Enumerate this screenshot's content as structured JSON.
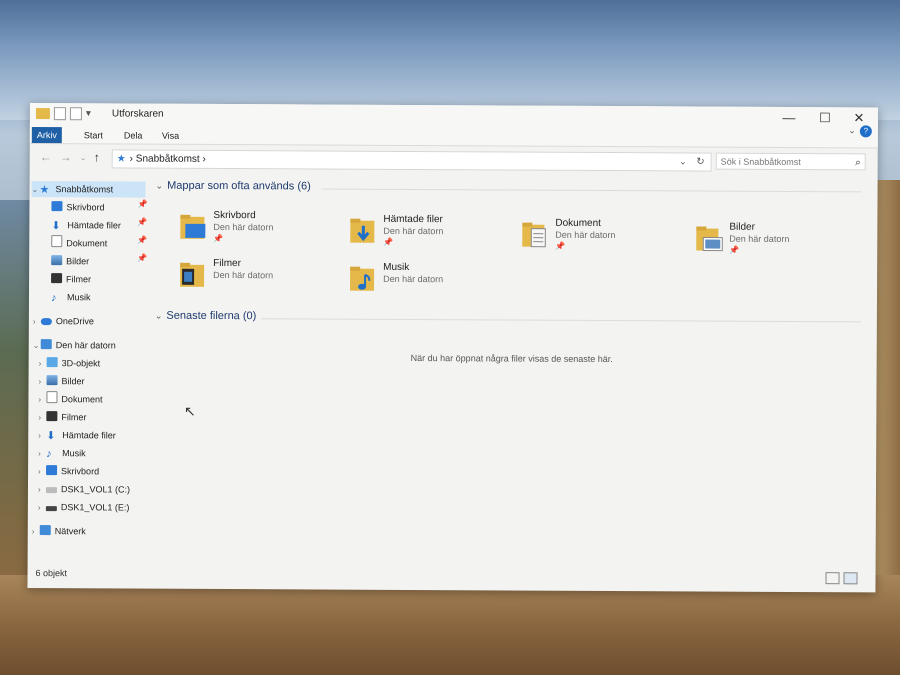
{
  "window": {
    "title": "Utforskaren",
    "controls": {
      "minimize": "—",
      "maximize": "☐",
      "close": "✕"
    }
  },
  "ribbon": {
    "tabs": [
      "Arkiv",
      "Start",
      "Dela",
      "Visa"
    ],
    "help": "?"
  },
  "address": {
    "path": "Snabbåtkomst",
    "search_placeholder": "Sök i Snabbåtkomst"
  },
  "sidebar": {
    "quick_access": "Snabbåtkomst",
    "quick_items": [
      "Skrivbord",
      "Hämtade filer",
      "Dokument",
      "Bilder",
      "Filmer",
      "Musik"
    ],
    "onedrive": "OneDrive",
    "this_pc": "Den här datorn",
    "pc_items": [
      "3D-objekt",
      "Bilder",
      "Dokument",
      "Filmer",
      "Hämtade filer",
      "Musik",
      "Skrivbord",
      "DSK1_VOL1 (C:)",
      "DSK1_VOL1 (E:)"
    ],
    "network": "Nätverk"
  },
  "main": {
    "frequent_header": "Mappar som ofta används (6)",
    "folders": [
      {
        "name": "Skrivbord",
        "location": "Den här datorn",
        "icon": "desktop-folder-icon"
      },
      {
        "name": "Hämtade filer",
        "location": "Den här datorn",
        "icon": "downloads-folder-icon"
      },
      {
        "name": "Dokument",
        "location": "Den här datorn",
        "icon": "documents-folder-icon"
      },
      {
        "name": "Bilder",
        "location": "Den här datorn",
        "icon": "pictures-folder-icon"
      },
      {
        "name": "Filmer",
        "location": "Den här datorn",
        "icon": "videos-folder-icon"
      },
      {
        "name": "Musik",
        "location": "Den här datorn",
        "icon": "music-folder-icon"
      }
    ],
    "recent_header": "Senaste filerna (0)",
    "empty_message": "När du har öppnat några filer visas de senaste här."
  },
  "status": {
    "count": "6 objekt"
  },
  "colors": {
    "accent": "#1f5fa6",
    "selection": "#cce4f7",
    "folder": "#e4b94a"
  }
}
